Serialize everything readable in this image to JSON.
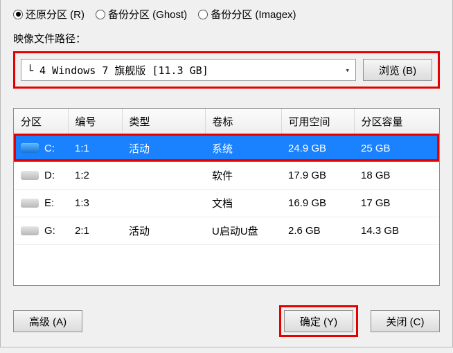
{
  "radios": {
    "restore": "还原分区 (R)",
    "ghost": "备份分区 (Ghost)",
    "imagex": "备份分区 (Imagex)"
  },
  "pathLabel": "映像文件路径：",
  "dropdownText": "└ 4 Windows 7 旗舰版 [11.3 GB]",
  "browseBtn": "浏览 (B)",
  "columns": {
    "partition": "分区",
    "number": "编号",
    "type": "类型",
    "volume": "卷标",
    "free": "可用空间",
    "capacity": "分区容量"
  },
  "rows": [
    {
      "icon": "blue",
      "part": "C:",
      "num": "1:1",
      "type": "活动",
      "vol": "系统",
      "free": "24.9 GB",
      "cap": "25 GB",
      "selected": true
    },
    {
      "icon": "gray",
      "part": "D:",
      "num": "1:2",
      "type": "",
      "vol": "软件",
      "free": "17.9 GB",
      "cap": "18 GB",
      "selected": false
    },
    {
      "icon": "gray",
      "part": "E:",
      "num": "1:3",
      "type": "",
      "vol": "文档",
      "free": "16.9 GB",
      "cap": "17 GB",
      "selected": false
    },
    {
      "icon": "gray",
      "part": "G:",
      "num": "2:1",
      "type": "活动",
      "vol": "U启动U盘",
      "free": "2.6 GB",
      "cap": "14.3 GB",
      "selected": false
    }
  ],
  "buttons": {
    "advanced": "高级 (A)",
    "ok": "确定 (Y)",
    "close": "关闭 (C)"
  }
}
